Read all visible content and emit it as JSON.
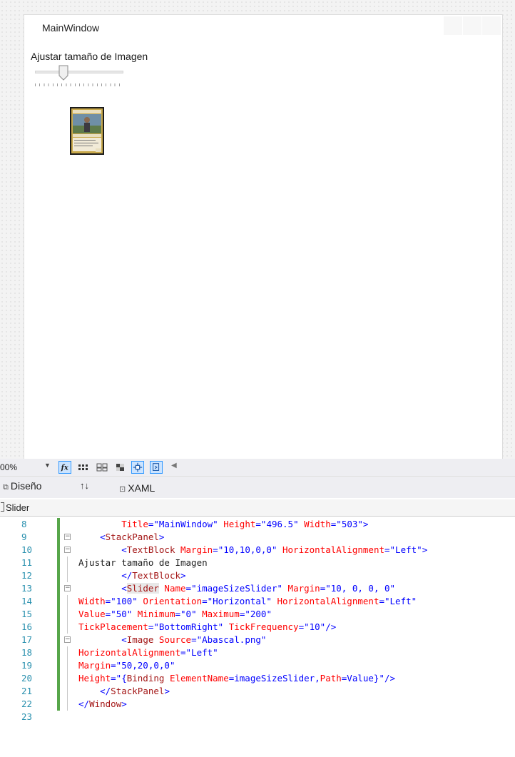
{
  "window": {
    "title": "MainWindow",
    "caption_text": "Ajustar tamaño de Imagen"
  },
  "slider": {
    "value": 50,
    "minimum": 0,
    "maximum": 200,
    "tick_frequency": 10
  },
  "toolbar": {
    "zoom": "00%"
  },
  "view_tabs": {
    "design": "Diseño",
    "xaml": "XAML"
  },
  "breadcrumb": {
    "label": "Slider"
  },
  "code_lines": [
    {
      "n": "8",
      "parts": [
        [
          "",
          "        "
        ],
        [
          "a",
          "Title"
        ],
        [
          "v",
          "=\"MainWindow\""
        ],
        [
          "a",
          " Height"
        ],
        [
          "v",
          "=\"496.5\""
        ],
        [
          "a",
          " Width"
        ],
        [
          "v",
          "=\"503\""
        ],
        [
          "v",
          ">"
        ]
      ]
    },
    {
      "n": "9",
      "parts": [
        [
          "",
          "    "
        ],
        [
          "v",
          "<"
        ],
        [
          "t",
          "StackPanel"
        ],
        [
          "v",
          ">"
        ]
      ]
    },
    {
      "n": "10",
      "parts": [
        [
          "",
          "        "
        ],
        [
          "v",
          "<"
        ],
        [
          "t",
          "TextBlock"
        ],
        [
          "a",
          " Margin"
        ],
        [
          "v",
          "=\"10,10,0,0\""
        ],
        [
          "a",
          " HorizontalAlignment"
        ],
        [
          "v",
          "=\"Left\""
        ],
        [
          "v",
          ">"
        ]
      ]
    },
    {
      "n": "11",
      "parts": [
        [
          "",
          "Ajustar tamaño de Imagen"
        ]
      ]
    },
    {
      "n": "12",
      "parts": [
        [
          "",
          "        "
        ],
        [
          "v",
          "</"
        ],
        [
          "t",
          "TextBlock"
        ],
        [
          "v",
          ">"
        ]
      ]
    },
    {
      "n": "13",
      "parts": [
        [
          "",
          "        "
        ],
        [
          "v",
          "<"
        ],
        [
          "t",
          "Slider"
        ],
        [
          "a",
          " Name"
        ],
        [
          "v",
          "=\"imageSizeSlider\""
        ],
        [
          "a",
          " Margin"
        ],
        [
          "v",
          "=\"10, 0, 0, 0\""
        ]
      ]
    },
    {
      "n": "14",
      "parts": [
        [
          "a",
          "Width"
        ],
        [
          "v",
          "=\"100\""
        ],
        [
          "a",
          " Orientation"
        ],
        [
          "v",
          "=\"Horizontal\""
        ],
        [
          "a",
          " HorizontalAlignment"
        ],
        [
          "v",
          "=\"Left\""
        ]
      ]
    },
    {
      "n": "15",
      "parts": [
        [
          "a",
          "Value"
        ],
        [
          "v",
          "=\"50\""
        ],
        [
          "a",
          " Minimum"
        ],
        [
          "v",
          "=\"0\""
        ],
        [
          "a",
          " Maximum"
        ],
        [
          "v",
          "=\"200\""
        ]
      ]
    },
    {
      "n": "16",
      "parts": [
        [
          "a",
          "TickPlacement"
        ],
        [
          "v",
          "=\"BottomRight\""
        ],
        [
          "a",
          " TickFrequency"
        ],
        [
          "v",
          "=\"10\""
        ],
        [
          "v",
          "/>"
        ]
      ]
    },
    {
      "n": "17",
      "parts": [
        [
          "",
          "        "
        ],
        [
          "v",
          "<"
        ],
        [
          "t",
          "Image"
        ],
        [
          "a",
          " Source"
        ],
        [
          "v",
          "=\"Abascal.png\""
        ]
      ]
    },
    {
      "n": "18",
      "parts": [
        [
          "a",
          "HorizontalAlignment"
        ],
        [
          "v",
          "=\"Left\""
        ]
      ]
    },
    {
      "n": "19",
      "parts": [
        [
          "a",
          "Margin"
        ],
        [
          "v",
          "=\"50,20,0,0\""
        ]
      ]
    },
    {
      "n": "20",
      "parts": [
        [
          "a",
          "Height"
        ],
        [
          "v",
          "=\"{"
        ],
        [
          "t",
          "Binding"
        ],
        [
          "a",
          " ElementName"
        ],
        [
          "v",
          "=imageSizeSlider,"
        ],
        [
          "a",
          "Path"
        ],
        [
          "v",
          "=Value}\""
        ],
        [
          "v",
          "/>"
        ]
      ]
    },
    {
      "n": "21",
      "parts": [
        [
          "",
          "    "
        ],
        [
          "v",
          "</"
        ],
        [
          "t",
          "StackPanel"
        ],
        [
          "v",
          ">"
        ]
      ]
    },
    {
      "n": "22",
      "parts": [
        [
          "v",
          "</"
        ],
        [
          "t",
          "Window"
        ],
        [
          "v",
          ">"
        ]
      ]
    },
    {
      "n": "23",
      "parts": []
    }
  ]
}
